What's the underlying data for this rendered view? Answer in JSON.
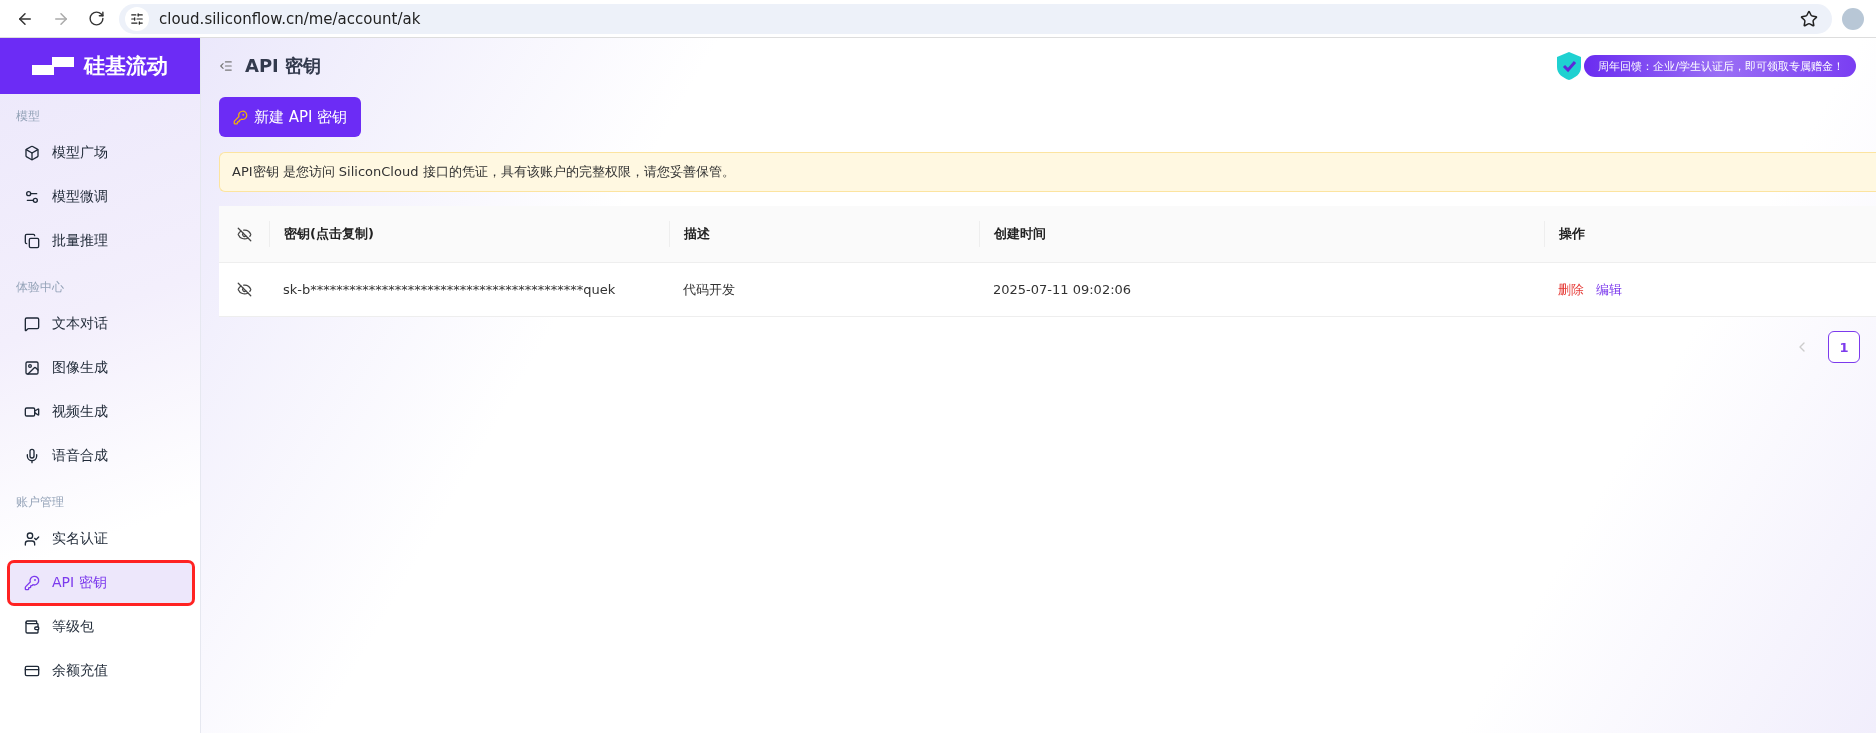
{
  "browser": {
    "url": "cloud.siliconflow.cn/me/account/ak",
    "forward_disabled": true
  },
  "sidebar": {
    "logo": "硅基流动",
    "sections": [
      {
        "title": "模型",
        "items": [
          {
            "label": "模型广场",
            "selected": false,
            "highlighted": false
          },
          {
            "label": "模型微调",
            "selected": false,
            "highlighted": false
          },
          {
            "label": "批量推理",
            "selected": false,
            "highlighted": false
          }
        ]
      },
      {
        "title": "体验中心",
        "items": [
          {
            "label": "文本对话",
            "selected": false,
            "highlighted": false
          },
          {
            "label": "图像生成",
            "selected": false,
            "highlighted": false
          },
          {
            "label": "视频生成",
            "selected": false,
            "highlighted": false
          },
          {
            "label": "语音合成",
            "selected": false,
            "highlighted": false
          }
        ]
      },
      {
        "title": "账户管理",
        "items": [
          {
            "label": "实名认证",
            "selected": false,
            "highlighted": false
          },
          {
            "label": "API 密钥",
            "selected": true,
            "highlighted": true
          },
          {
            "label": "等级包",
            "selected": false,
            "highlighted": false
          },
          {
            "label": "余额充值",
            "selected": false,
            "highlighted": false
          }
        ]
      }
    ]
  },
  "header": {
    "title": "API 密钥",
    "promo": "周年回馈：企业/学生认证后，即可领取专属赠金！"
  },
  "new_button": "新建 API 密钥",
  "notice": "API密钥 是您访问 SiliconCloud 接口的凭证，具有该账户的完整权限，请您妥善保管。",
  "table": {
    "columns": [
      "密钥(点击复制)",
      "描述",
      "创建时间",
      "操作"
    ],
    "rows": [
      {
        "key": "sk-b******************************************quek",
        "description": "代码开发",
        "created": "2025-07-11 09:02:06",
        "actions": [
          {
            "label": "删除",
            "kind": "danger"
          },
          {
            "label": "编辑",
            "kind": "primary"
          }
        ]
      }
    ]
  },
  "pagination": {
    "prev_disabled": true,
    "pages": [
      {
        "label": "1",
        "selected": true
      }
    ]
  }
}
